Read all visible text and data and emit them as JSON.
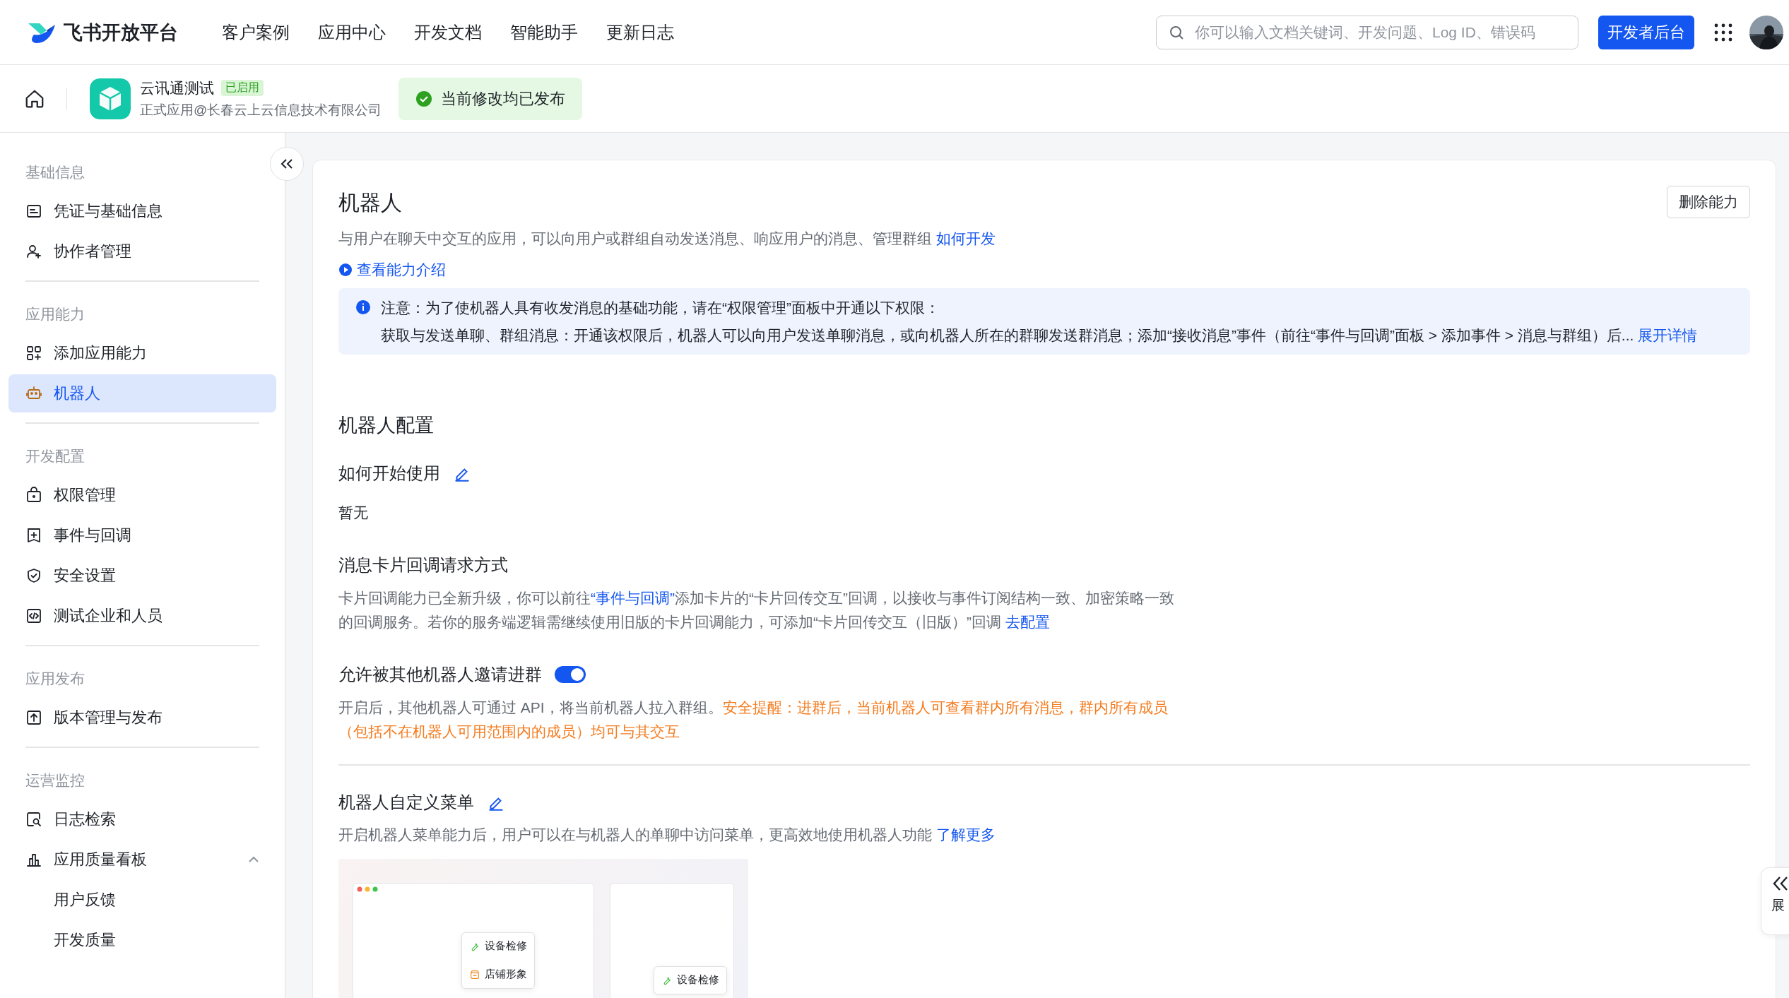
{
  "header": {
    "logo": "飞书开放平台",
    "nav": [
      {
        "label": "客户案例",
        "selected": false
      },
      {
        "label": "应用中心",
        "selected": false
      },
      {
        "label": "开发文档",
        "selected": false
      },
      {
        "label": "智能助手",
        "selected": false
      },
      {
        "label": "更新日志",
        "selected": false
      }
    ],
    "search": {
      "placeholder": "你可以输入文档关键词、开发问题、Log ID、错误码"
    },
    "console_button": "开发者后台"
  },
  "app_bar": {
    "name": "云讯通测试",
    "status": "已启用",
    "subtitle": "正式应用@长春云上云信息技术有限公司",
    "notice": "当前修改均已发布"
  },
  "sidebar": {
    "groups": [
      {
        "title": "基础信息",
        "items": [
          {
            "label": "凭证与基础信息",
            "selected": false
          },
          {
            "label": "协作者管理",
            "selected": false
          }
        ]
      },
      {
        "title": "应用能力",
        "items": [
          {
            "label": "添加应用能力",
            "selected": false
          },
          {
            "label": "机器人",
            "selected": true
          }
        ]
      },
      {
        "title": "开发配置",
        "items": [
          {
            "label": "权限管理",
            "selected": false
          },
          {
            "label": "事件与回调",
            "selected": false
          },
          {
            "label": "安全设置",
            "selected": false
          },
          {
            "label": "测试企业和人员",
            "selected": false
          }
        ]
      },
      {
        "title": "应用发布",
        "items": [
          {
            "label": "版本管理与发布",
            "selected": false
          }
        ]
      },
      {
        "title": "运营监控",
        "items": [
          {
            "label": "日志检索",
            "selected": false
          },
          {
            "label": "应用质量看板",
            "selected": false,
            "expanded": true,
            "children": [
              {
                "label": "用户反馈",
                "selected": false
              },
              {
                "label": "开发质量",
                "selected": false
              }
            ]
          }
        ]
      }
    ]
  },
  "main": {
    "title": "机器人",
    "delete_button": "删除能力",
    "description": "与用户在聊天中交互的应用，可以向用户或群组自动发送消息、响应用户的消息、管理群组",
    "description_link": "如何开发",
    "intro_link": "查看能力介绍",
    "notice": {
      "title": "注意：为了使机器人具有收发消息的基础功能，请在“权限管理”面板中开通以下权限：",
      "body": "获取与发送单聊、群组消息：开通该权限后，机器人可以向用户发送单聊消息，或向机器人所在的群聊发送群消息；添加“接收消息”事件（前往“事件与回调”面板 > 添加事件 > 消息与群组）后...",
      "more": "展开详情"
    },
    "config": {
      "heading": "机器人配置",
      "how_to_use": {
        "title": "如何开始使用",
        "value": "暂无"
      },
      "card_callback": {
        "title": "消息卡片回调请求方式",
        "parts": [
          {
            "kind": "text",
            "text": "卡片回调能力已全新升级，你可以前往"
          },
          {
            "kind": "link",
            "text": "“事件与回调”"
          },
          {
            "kind": "text",
            "text": "添加卡片的“卡片回传交互”回调，以接收与事件订阅结构一致、加密策略一致的回调服务。若你的服务端逻辑需继续使用旧版的卡片回调能力，可添加“卡片回传交互（旧版）”回调 "
          },
          {
            "kind": "link",
            "text": "去配置"
          }
        ]
      },
      "invite": {
        "label": "允许被其他机器人邀请进群",
        "on": true,
        "description": "开启后，其他机器人可通过 API，将当前机器人拉入群组。",
        "warning": "安全提醒：进群后，当前机器人可查看群内所有消息，群内所有成员（包括不在机器人可用范围内的成员）均可与其交互"
      },
      "custom_menu": {
        "title": "机器人自定义菜单",
        "description": "开启机器人菜单能力后，用户可以在与机器人的单聊中访问菜单，更高效地使用机器人功能",
        "link": "了解更多",
        "preview": {
          "desktop_items": [
            {
              "label": "设备检修"
            },
            {
              "label": "店铺形象"
            }
          ],
          "mobile_items": [
            {
              "label": "设备检修"
            }
          ]
        }
      }
    }
  },
  "side_tab": {
    "label": "展"
  }
}
